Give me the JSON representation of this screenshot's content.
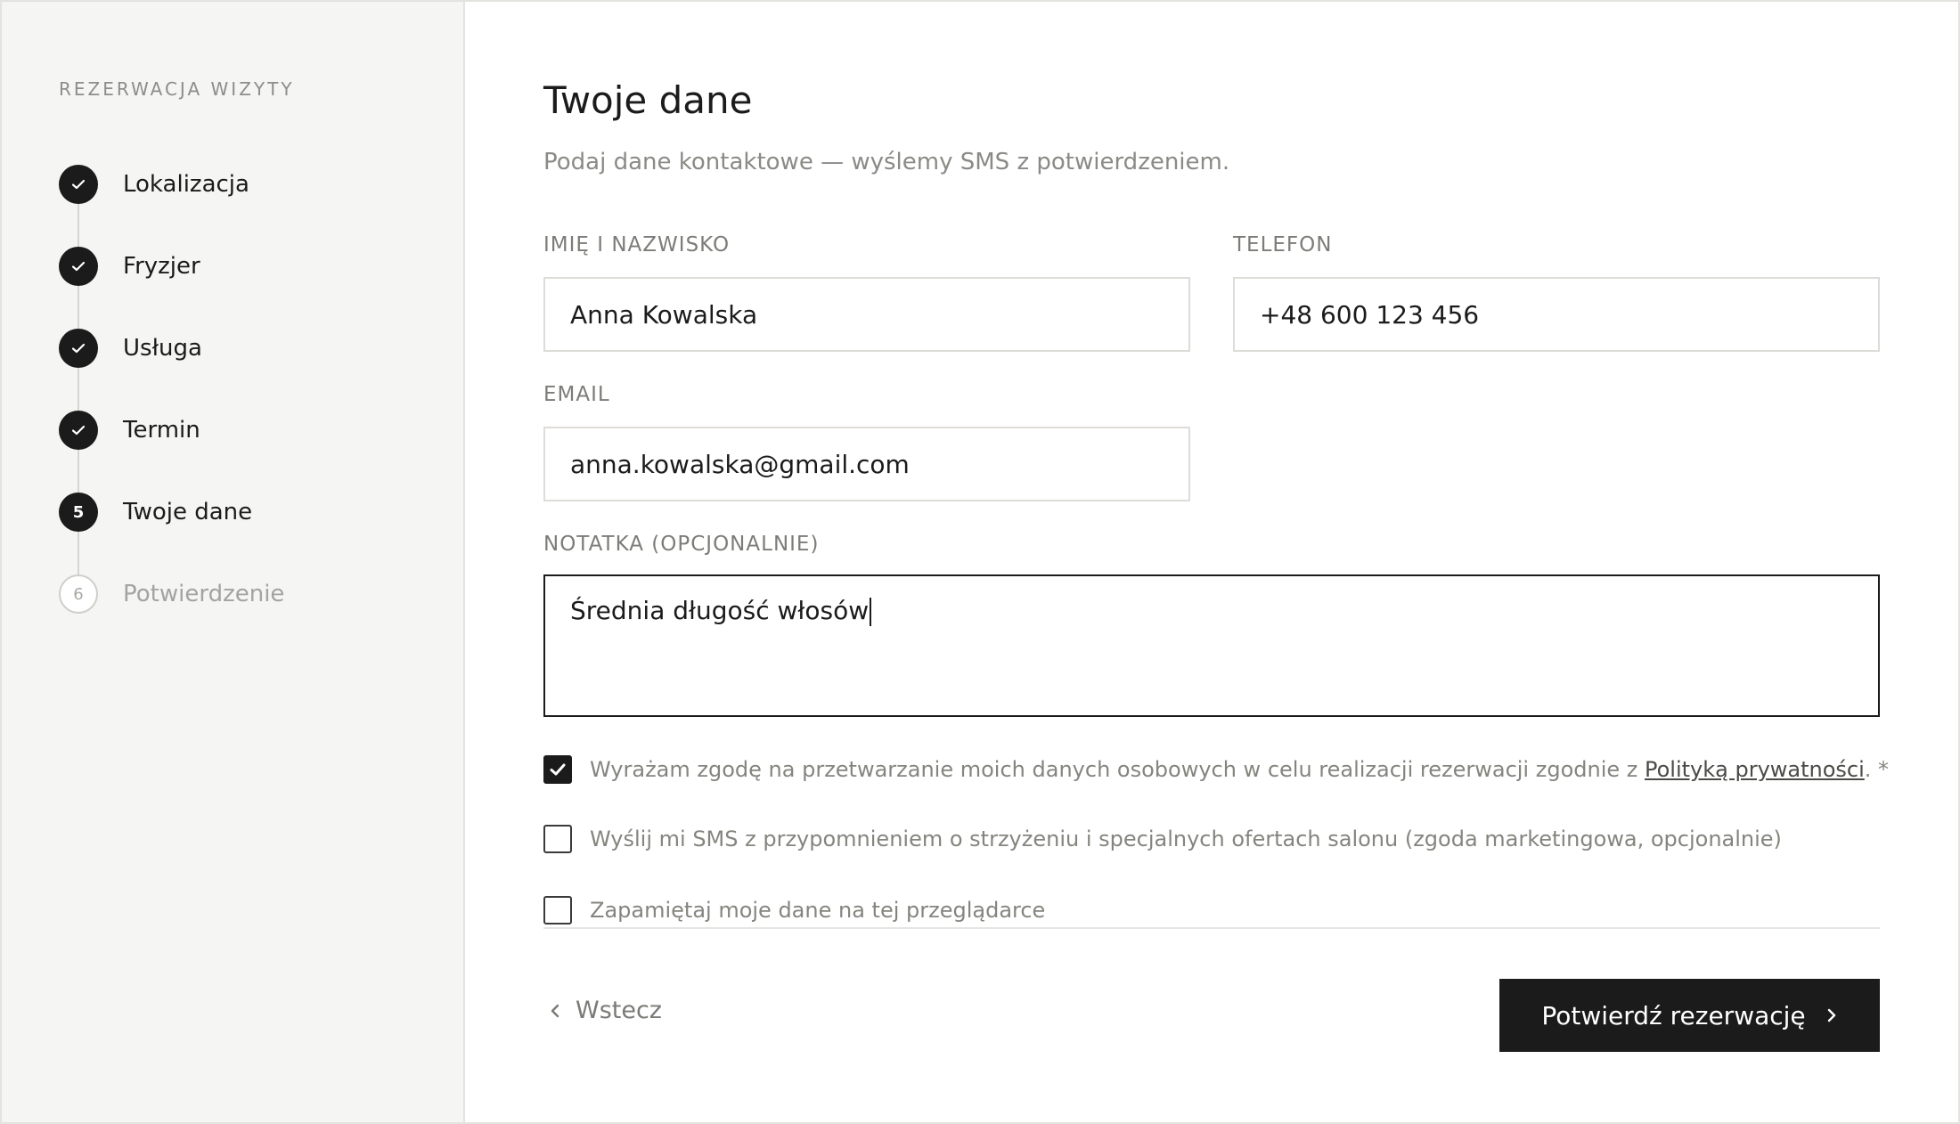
{
  "sidebar": {
    "title": "REZERWACJA WIZYTY",
    "steps": [
      {
        "label": "Lokalizacja",
        "state": "done"
      },
      {
        "label": "Fryzjer",
        "state": "done"
      },
      {
        "label": "Usługa",
        "state": "done"
      },
      {
        "label": "Termin",
        "state": "done"
      },
      {
        "label": "Twoje dane",
        "state": "active",
        "number": "5"
      },
      {
        "label": "Potwierdzenie",
        "state": "pending",
        "number": "6"
      }
    ]
  },
  "main": {
    "title": "Twoje dane",
    "subtitle": "Podaj dane kontaktowe — wyślemy SMS z potwierdzeniem.",
    "fields": {
      "name": {
        "label": "IMIĘ I NAZWISKO",
        "value": "Anna Kowalska"
      },
      "phone": {
        "label": "TELEFON",
        "value": "+48 600 123 456"
      },
      "email": {
        "label": "EMAIL",
        "value": "anna.kowalska@gmail.com"
      },
      "note": {
        "label": "NOTATKA (OPCJONALNIE)",
        "value": "Średnia długość włosów"
      }
    },
    "consents": [
      {
        "text_before": "Wyrażam zgodę na przetwarzanie moich danych osobowych w celu realizacji rezerwacji zgodnie z ",
        "link": "Polityką prywatności",
        "text_after": ". *",
        "checked": true
      },
      {
        "text": "Wyślij mi SMS z przypomnieniem o strzyżeniu i specjalnych ofertach salonu (zgoda marketingowa, opcjonalnie)",
        "checked": false
      },
      {
        "text": "Zapamiętaj moje dane na tej przeglądarce",
        "checked": false
      }
    ],
    "back_label": "Wstecz",
    "confirm_label": "Potwierdź rezerwację"
  },
  "colors": {
    "accent": "#1b1b1b",
    "sidebar_bg": "#f5f5f3",
    "muted_text": "#8a8a86"
  }
}
